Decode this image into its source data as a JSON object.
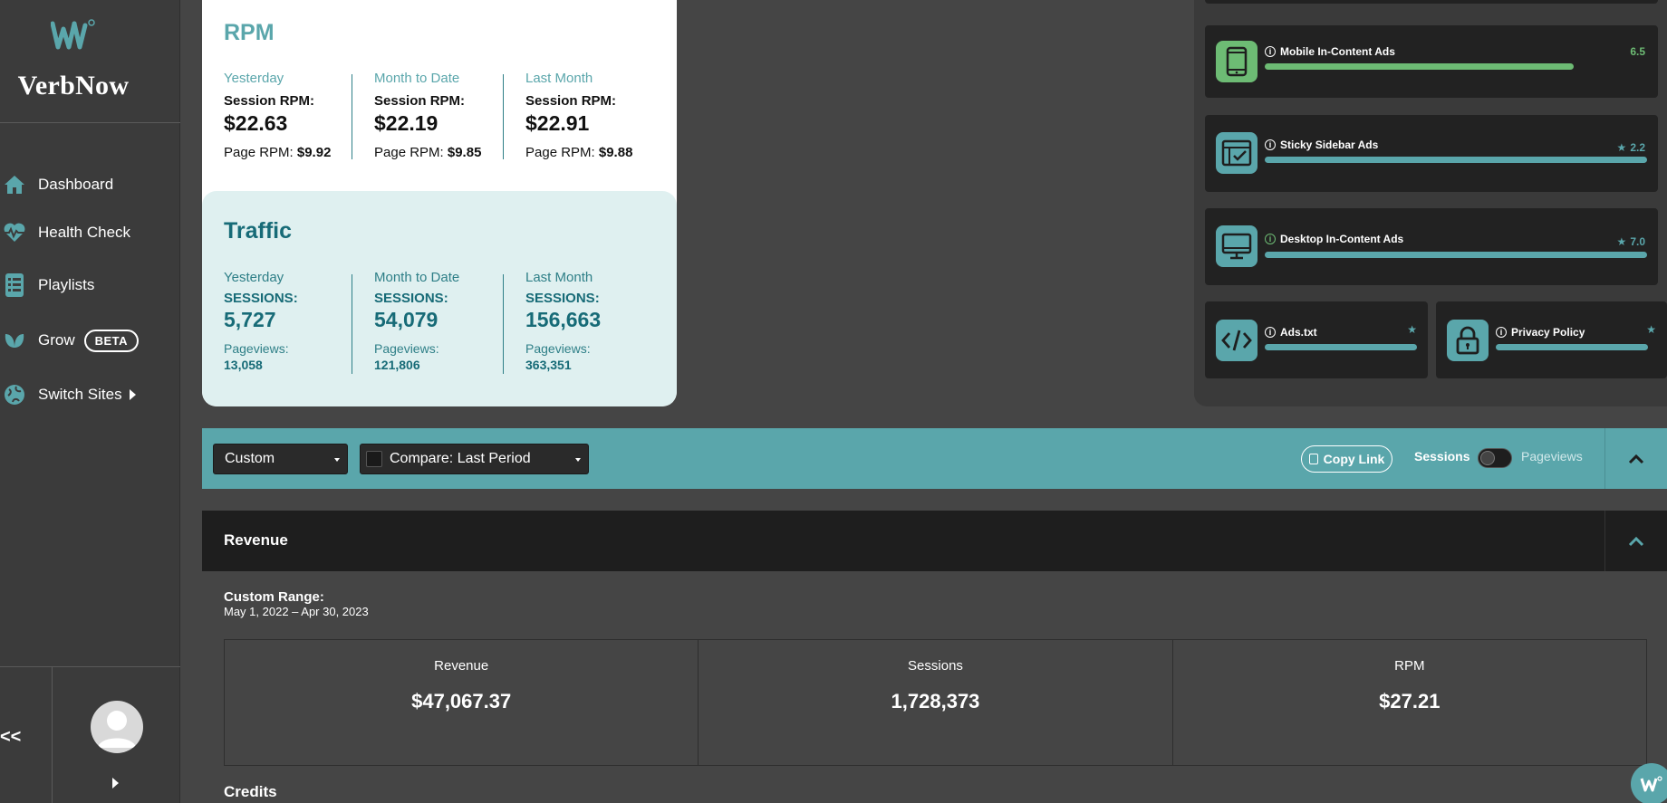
{
  "brand": {
    "name": "VerbNow",
    "accent": "#5aa6ab",
    "dark_accent": "#176b77"
  },
  "sidebar": {
    "items": [
      {
        "label": "Dashboard",
        "icon": "home-icon"
      },
      {
        "label": "Health Check",
        "icon": "heartbeat-icon"
      },
      {
        "label": "Playlists",
        "icon": "list-icon"
      },
      {
        "label": "Grow",
        "icon": "leaf-icon",
        "badge": "BETA"
      },
      {
        "label": "Switch Sites",
        "icon": "globe-icon"
      }
    ],
    "collapse_label": "<<"
  },
  "rpm": {
    "title": "RPM",
    "columns": [
      {
        "period": "Yesterday",
        "sub_label": "Session RPM:",
        "big": "$22.63",
        "small_label": "Page RPM:",
        "small_value": "$9.92"
      },
      {
        "period": "Month to Date",
        "sub_label": "Session RPM:",
        "big": "$22.19",
        "small_label": "Page RPM:",
        "small_value": "$9.85"
      },
      {
        "period": "Last Month",
        "sub_label": "Session RPM:",
        "big": "$22.91",
        "small_label": "Page RPM:",
        "small_value": "$9.88"
      }
    ]
  },
  "traffic": {
    "title": "Traffic",
    "columns": [
      {
        "period": "Yesterday",
        "sub_label": "SESSIONS:",
        "big": "5,727",
        "small_label": "Pageviews:",
        "small_value": "13,058"
      },
      {
        "period": "Month to Date",
        "sub_label": "SESSIONS:",
        "big": "54,079",
        "small_label": "Pageviews:",
        "small_value": "121,806"
      },
      {
        "period": "Last Month",
        "sub_label": "SESSIONS:",
        "big": "156,663",
        "small_label": "Pageviews:",
        "small_value": "363,351"
      }
    ]
  },
  "ads": [
    {
      "title": "Mobile In-Content Ads",
      "score": "6.5",
      "icon": "mobile-icon",
      "color": "#6dbb74",
      "fill": 0.94,
      "starred": false
    },
    {
      "title": "Sticky Sidebar Ads",
      "score": "2.2",
      "icon": "browser-check-icon",
      "color": "#5aa6ab",
      "fill": 1.0,
      "starred": true
    },
    {
      "title": "Desktop In-Content Ads",
      "score": "7.0",
      "icon": "desktop-icon",
      "color": "#5aa6ab",
      "fill": 1.0,
      "starred": true
    },
    {
      "title": "Ads.txt",
      "score": "",
      "icon": "code-icon",
      "color": "#5aa6ab",
      "fill": 1.0,
      "starred": true
    },
    {
      "title": "Privacy Policy",
      "score": "",
      "icon": "lock-icon",
      "color": "#5aa6ab",
      "fill": 1.0,
      "starred": true
    }
  ],
  "toolbar": {
    "range_select": "Custom",
    "compare_select": "Compare: Last Period",
    "copy_link": "Copy Link",
    "toggle_left": "Sessions",
    "toggle_right": "Pageviews"
  },
  "revenue": {
    "title": "Revenue",
    "range_label": "Custom Range:",
    "range_value": "May 1, 2022 – Apr 30, 2023",
    "summary": [
      {
        "label": "Revenue",
        "value": "$47,067.37"
      },
      {
        "label": "Sessions",
        "value": "1,728,373"
      },
      {
        "label": "RPM",
        "value": "$27.21"
      }
    ],
    "credits_title": "Credits"
  }
}
